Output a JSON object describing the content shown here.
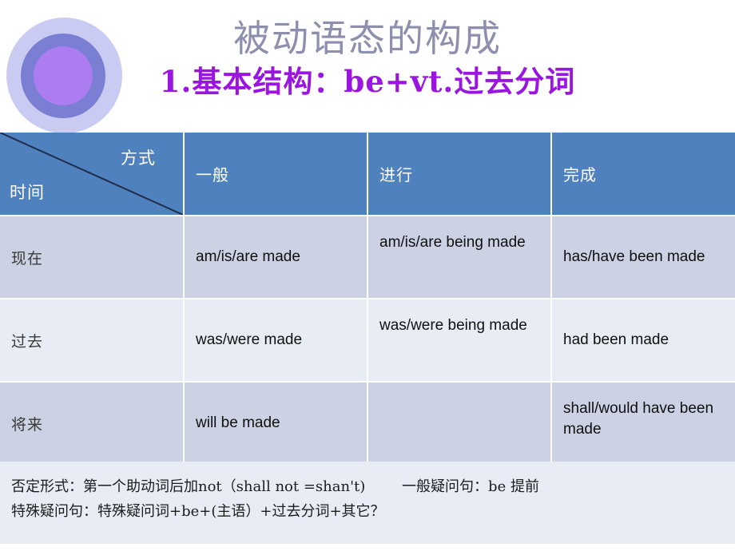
{
  "slide": {
    "main_title": "被动语态的构成",
    "sub_title": "1.基本结构：be+vt.过去分词",
    "logo_name": "concentric-circles-decoration"
  },
  "colors": {
    "title": "#8e8fae",
    "subtitle": "#9a16e0",
    "header_bg": "#4e81bd",
    "band_a": "#ccd2e3",
    "band_b": "#e8ecf5",
    "diagonal": "#1f2d4a",
    "logo_outer": "#c9cbf2",
    "logo_mid": "#7b7fd4",
    "logo_inner": "#ab7df0"
  },
  "table": {
    "corner": {
      "top_right_label": "方式",
      "bottom_left_label": "时间"
    },
    "columns": [
      "一般",
      "进行",
      "完成"
    ],
    "rows": [
      {
        "time": "现在",
        "simple": "am/is/are made",
        "progressive": "am/is/are being made",
        "perfect": "has/have been made"
      },
      {
        "time": "过去",
        "simple": "was/were made",
        "progressive": "was/were being made",
        "perfect": "had been made"
      },
      {
        "time": "将来",
        "simple": "will be made",
        "progressive": "",
        "perfect": "shall/would have been made"
      }
    ]
  },
  "notes": {
    "line1": "否定形式：第一个助动词后加not（shall not =shan't)        一般疑问句：be 提前",
    "line2": "特殊疑问句：特殊疑问词+be+(主语）+过去分词+其它？"
  }
}
